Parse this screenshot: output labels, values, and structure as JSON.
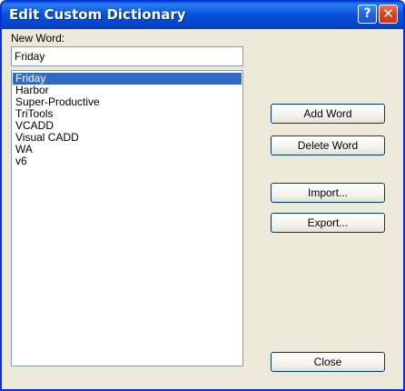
{
  "window": {
    "title": "Edit Custom Dictionary",
    "help_glyph": "?",
    "close_glyph": "✕"
  },
  "new_word": {
    "label": "New Word:",
    "value": "Friday"
  },
  "word_list": {
    "items": [
      "Friday",
      "Harbor",
      "Super-Productive",
      "TriTools",
      "VCADD",
      "Visual CADD",
      "WA",
      "v6"
    ],
    "selected_index": 0
  },
  "buttons": {
    "add": "Add Word",
    "delete": "Delete Word",
    "import": "Import...",
    "export": "Export...",
    "close": "Close"
  },
  "colors": {
    "titlebar": "#0852dc",
    "selection": "#316ac5",
    "window_bg": "#ece9d8"
  }
}
